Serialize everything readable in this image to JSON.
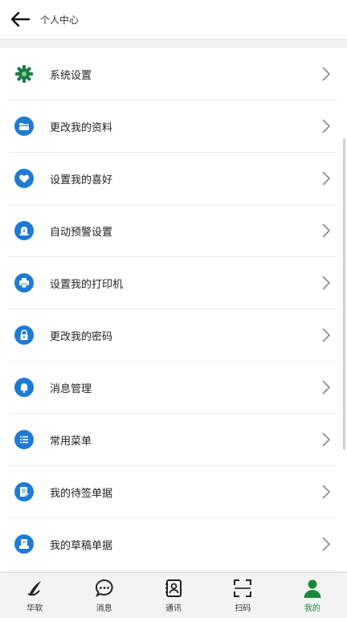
{
  "header": {
    "title": "个人中心"
  },
  "menu": {
    "items": [
      {
        "label": "系统设置"
      },
      {
        "label": "更改我的资料"
      },
      {
        "label": "设置我的喜好"
      },
      {
        "label": "自动预警设置"
      },
      {
        "label": "设置我的打印机"
      },
      {
        "label": "更改我的密码"
      },
      {
        "label": "消息管理"
      },
      {
        "label": "常用菜单"
      },
      {
        "label": "我的待签单据"
      },
      {
        "label": "我的草稿单据"
      }
    ]
  },
  "tabbar": {
    "tabs": [
      {
        "label": "华软"
      },
      {
        "label": "消息"
      },
      {
        "label": "通讯"
      },
      {
        "label": "扫码"
      },
      {
        "label": "我的"
      }
    ],
    "active": "我的"
  },
  "colors": {
    "accent_blue": "#1e7ad6",
    "active_green": "#1a8a3a",
    "gear_green": "#1d7a4a"
  }
}
